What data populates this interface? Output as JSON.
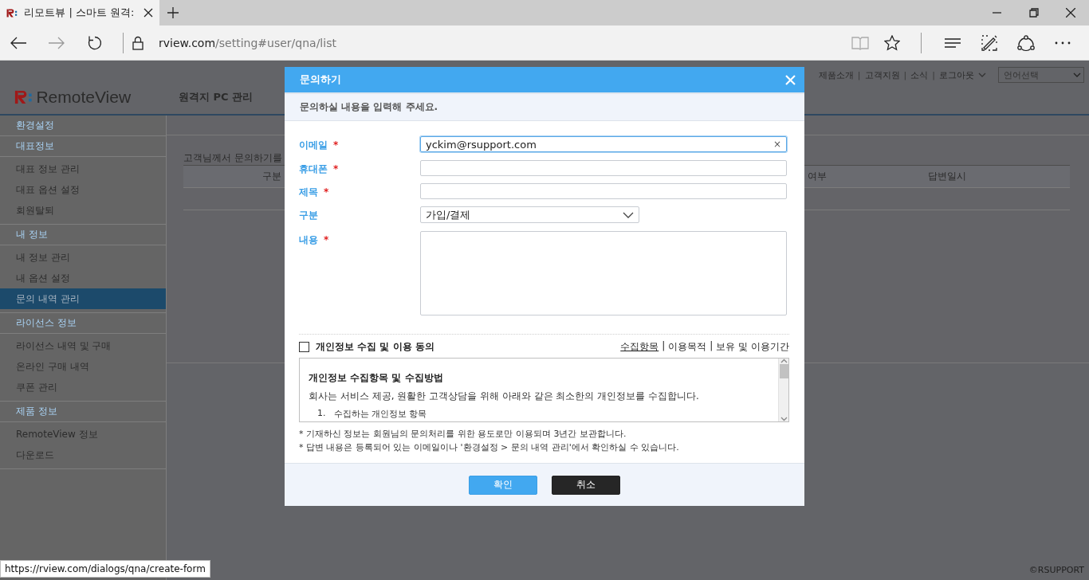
{
  "browser": {
    "tab_title": "리모트뷰 | 스마트 원격:",
    "url_host": "rview.com",
    "url_path": "/setting#user/qna/list",
    "status_url": "https://rview.com/dialogs/qna/create-form"
  },
  "header": {
    "links": [
      "제품소개",
      "고객지원",
      "소식",
      "로그아웃"
    ],
    "link_separator": "|",
    "language_select": "언어선택",
    "logo": "RemoteView",
    "menu": "원격지 PC 관리"
  },
  "sidebar": {
    "title": "환경설정",
    "sections": [
      {
        "title": "대표정보",
        "items": [
          {
            "label": "대표 정보 관리",
            "selected": false
          },
          {
            "label": "대표 옵션 설정",
            "selected": false
          },
          {
            "label": "회원탈퇴",
            "selected": false
          }
        ]
      },
      {
        "title": "내 정보",
        "items": [
          {
            "label": "내 정보 관리",
            "selected": false
          },
          {
            "label": "내 옵션 설정",
            "selected": false
          },
          {
            "label": "문의 내역 관리",
            "selected": true
          }
        ]
      },
      {
        "title": "라이선스 정보",
        "items": [
          {
            "label": "라이선스 내역 및 구매",
            "selected": false
          },
          {
            "label": "온라인 구매 내역",
            "selected": false
          },
          {
            "label": "쿠폰 관리",
            "selected": false
          }
        ]
      },
      {
        "title": "제품 정보",
        "items": [
          {
            "label": "RemoteView 정보",
            "selected": false
          },
          {
            "label": "다운로드",
            "selected": false
          }
        ]
      }
    ]
  },
  "content": {
    "intro": "고객님께서 문의하기를",
    "columns": [
      "구분",
      "여부",
      "답변일시"
    ]
  },
  "footer": {
    "copyright": "©RSUPPORT"
  },
  "dialog": {
    "title": "문의하기",
    "subtitle": "문의하실 내용을 입력해 주세요.",
    "required_mark": "*",
    "fields": [
      {
        "label": "이메일",
        "required": true,
        "kind": "text",
        "value": "yckim@rsupport.com",
        "focused": true,
        "clear_button": "×"
      },
      {
        "label": "휴대폰",
        "required": true,
        "kind": "text",
        "focused": false
      },
      {
        "label": "제목",
        "required": true,
        "kind": "text",
        "focused": false
      },
      {
        "label": "구분",
        "required": false,
        "kind": "select",
        "value": "가입/결제",
        "focused": false
      },
      {
        "label": "내용",
        "required": true,
        "kind": "textarea",
        "focused": false
      }
    ],
    "consent": {
      "label": "개인정보 수집 및 이용 동의",
      "checked": false,
      "separator": "|",
      "links": [
        {
          "label": "수집항목",
          "selected": true
        },
        {
          "label": "이용목적",
          "selected": false
        },
        {
          "label": "보유 및 이용기간",
          "selected": false
        }
      ]
    },
    "policy": {
      "heading": "개인정보 수집항목 및 수집방법",
      "text": "회사는 서비스 제공, 원활한 고객상담을 위해 아래와 같은 최소한의 개인정보를 수집합니다.",
      "list_item": {
        "number": "1.",
        "text": "수집하는 개인정보 항목"
      }
    },
    "notes": [
      "* 기재하신 정보는 회원님의 문의처리를 위한 용도로만 이용되며 3년간 보관합니다.",
      "* 답변 내용은 등록되어 있는 이메일이나 '환경설정 > 문의 내역 관리'에서 확인하실 수 있습니다."
    ],
    "buttons": [
      {
        "label": "확인",
        "kind": "primary"
      },
      {
        "label": "취소",
        "kind": "secondary"
      }
    ]
  }
}
